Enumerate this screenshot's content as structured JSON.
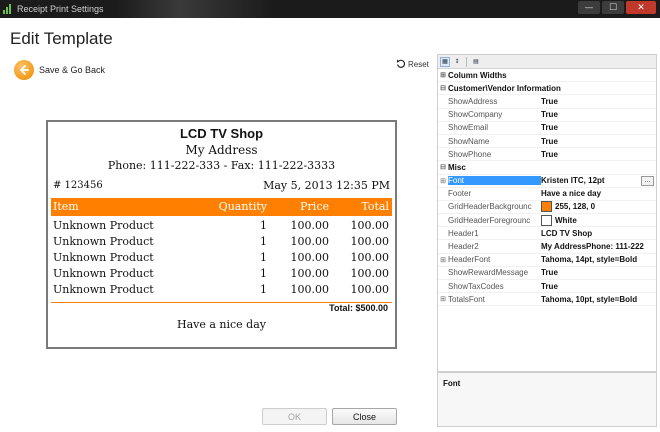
{
  "window": {
    "title": "Receipt Print Settings",
    "buttons": {
      "minimize": "—",
      "maximize": "☐",
      "close": "✕"
    }
  },
  "page_title": "Edit Template",
  "back_label": "Save & Go Back",
  "reset_label": "Reset",
  "receipt": {
    "header1": "LCD TV Shop",
    "header2": "My Address",
    "header3": "Phone: 111-222-333 - Fax: 111-222-3333",
    "receipt_number": "# 123456",
    "date": "May 5, 2013 12:35 PM",
    "columns": {
      "item": "Item",
      "quantity": "Quantity",
      "price": "Price",
      "total": "Total"
    },
    "rows": [
      {
        "item": "Unknown Product",
        "quantity": "1",
        "price": "100.00",
        "total": "100.00"
      },
      {
        "item": "Unknown Product",
        "quantity": "1",
        "price": "100.00",
        "total": "100.00"
      },
      {
        "item": "Unknown Product",
        "quantity": "1",
        "price": "100.00",
        "total": "100.00"
      },
      {
        "item": "Unknown Product",
        "quantity": "1",
        "price": "100.00",
        "total": "100.00"
      },
      {
        "item": "Unknown Product",
        "quantity": "1",
        "price": "100.00",
        "total": "100.00"
      }
    ],
    "total_line": "Total: $500.00",
    "footer": "Have a nice day",
    "header_color": "#ff8000"
  },
  "property_grid": {
    "categories": [
      {
        "name": "Column Widths",
        "rows": []
      },
      {
        "name": "Customer\\Vendor Information",
        "rows": [
          {
            "name": "ShowAddress",
            "value": "True"
          },
          {
            "name": "ShowCompany",
            "value": "True"
          },
          {
            "name": "ShowEmail",
            "value": "True"
          },
          {
            "name": "ShowName",
            "value": "True"
          },
          {
            "name": "ShowPhone",
            "value": "True"
          }
        ]
      },
      {
        "name": "Misc",
        "rows": [
          {
            "name": "Font",
            "value": "Kristen ITC, 12pt"
          },
          {
            "name": "Footer",
            "value": "Have a nice day"
          },
          {
            "name": "GridHeaderBackgrounc",
            "value": "255, 128, 0"
          },
          {
            "name": "GridHeaderForegrounc",
            "value": "White"
          },
          {
            "name": "Header1",
            "value": "LCD TV Shop"
          },
          {
            "name": "Header2",
            "value": "My AddressPhone: 111-222"
          },
          {
            "name": "HeaderFont",
            "value": "Tahoma, 14pt, style=Bold"
          },
          {
            "name": "ShowRewardMessage",
            "value": "True"
          },
          {
            "name": "ShowTaxCodes",
            "value": "True"
          },
          {
            "name": "TotalsFont",
            "value": "Tahoma, 10pt, style=Bold"
          }
        ]
      }
    ],
    "swatches": {
      "background": "#ff8000",
      "foreground": "#ffffff"
    },
    "ellipsis": "...",
    "description_title": "Font"
  },
  "buttons": {
    "ok": "OK",
    "close": "Close"
  }
}
